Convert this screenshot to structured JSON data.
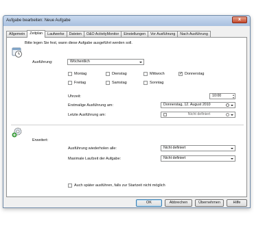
{
  "window": {
    "title": "Aufgabe bearbeiten: Neue Aufgabe",
    "close_glyph": "x"
  },
  "tabs": [
    {
      "label": "Allgemein"
    },
    {
      "label": "Zeitplan"
    },
    {
      "label": "Laufwerke"
    },
    {
      "label": "Dateien"
    },
    {
      "label": "O&O ActivityMonitor"
    },
    {
      "label": "Einstellungen"
    },
    {
      "label": "Vor Ausführung"
    },
    {
      "label": "Nach Ausführung"
    }
  ],
  "active_tab": "Zeitplan",
  "intro_text": "Bitte legen Sie fest, wann diese Aufgabe ausgeführt werden soll.",
  "schedule": {
    "label": "Ausführung:",
    "value": "Wöchentlich",
    "days": [
      {
        "label": "Montag",
        "checked": false
      },
      {
        "label": "Dienstag",
        "checked": false
      },
      {
        "label": "Mittwoch",
        "checked": false
      },
      {
        "label": "Donnerstag",
        "checked": true
      },
      {
        "label": "Freitag",
        "checked": false
      },
      {
        "label": "Samstag",
        "checked": false
      },
      {
        "label": "Sonntag",
        "checked": false
      }
    ],
    "time_label": "Uhrzeit:",
    "time_value": "10:00",
    "first_run_label": "Erstmalige Ausführung am:",
    "first_run_value": "Donnerstag, 12. August 2010",
    "last_run_label": "Letzte Ausführung am:",
    "last_run_value": "Nicht definiert"
  },
  "advanced": {
    "label": "Erweitert:",
    "repeat_label": "Ausführung wiederholen alle:",
    "repeat_value": "Nicht definiert",
    "max_runtime_label": "Maximale Laufzeit der Aufgabe:",
    "max_runtime_value": "Nicht definiert",
    "run_later_label": "Auch später ausführen, falls zur Startzeit nicht möglich",
    "run_later_checked": false
  },
  "buttons": {
    "ok": "OK",
    "cancel": "Abbrechen",
    "apply": "Übernehmen",
    "help": "Hilfe"
  },
  "icons": {
    "schedule": "calendar-clock-icon",
    "advanced": "gear-add-icon"
  }
}
